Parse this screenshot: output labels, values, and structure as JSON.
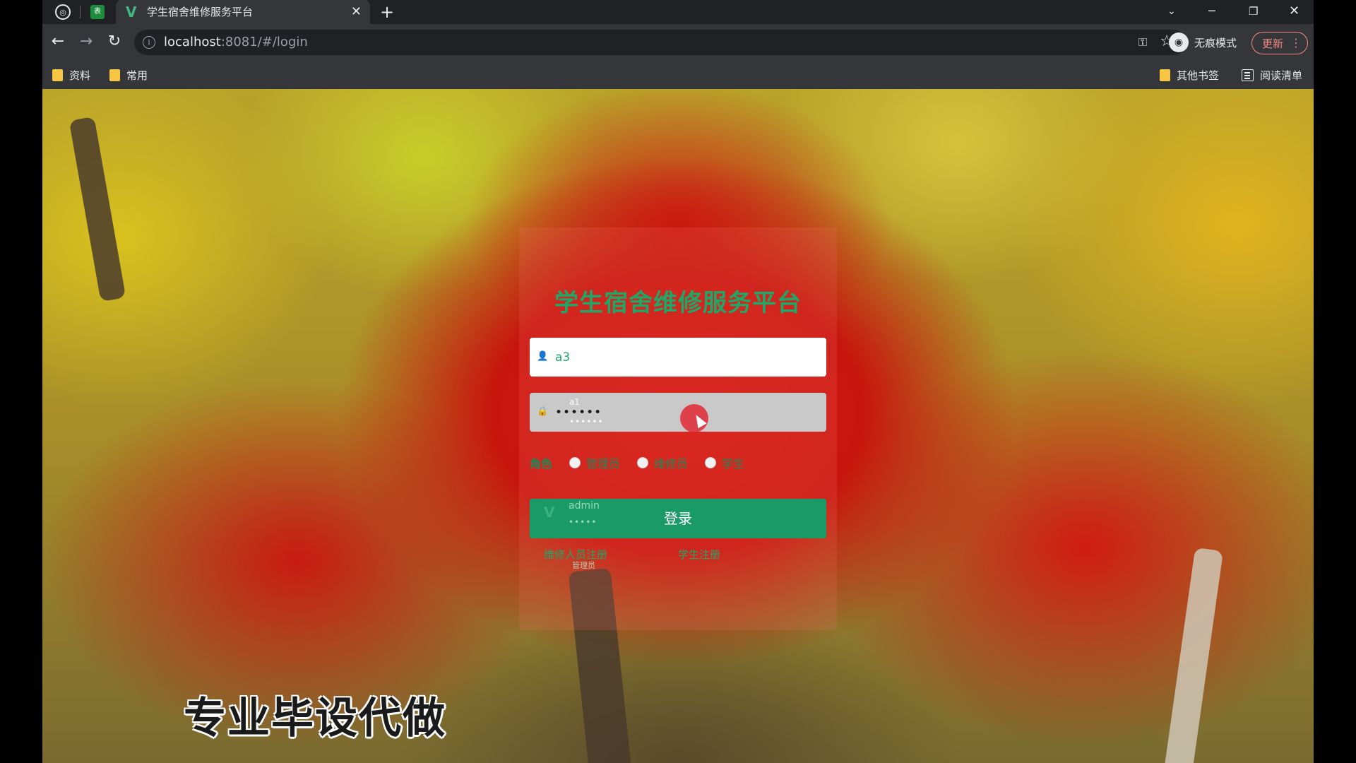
{
  "browser": {
    "tab": {
      "title": "学生宿舍维修服务平台",
      "favicon": "V",
      "app_icon": "表",
      "close": "✕",
      "new_tab": "+"
    },
    "window_controls": {
      "tablist": "⌄",
      "minimize": "─",
      "maximize": "❐",
      "close": "✕"
    },
    "address": {
      "host": "localhost",
      "rest": ":8081/#/login"
    },
    "incognito_label": "无痕模式",
    "update_label": "更新",
    "bookmarks": [
      {
        "label": "资料"
      },
      {
        "label": "常用"
      },
      {
        "label": "其他书签"
      },
      {
        "label": "阅读清单"
      }
    ]
  },
  "login": {
    "title": "学生宿舍维修服务平台",
    "username_value": "a3",
    "password_value": "••••••",
    "autofill_hint_user": "a1",
    "autofill_hint_dots": "••••••",
    "role_label": "角色",
    "roles": [
      {
        "label": "管理员"
      },
      {
        "label": "维修员"
      },
      {
        "label": "学生"
      }
    ],
    "login_button": "登录",
    "button_ghost_user": "admin",
    "button_ghost_dots": "•••••",
    "register_links": [
      {
        "label": "维修人员注册"
      },
      {
        "label": "学生注册"
      }
    ],
    "ghost_admin": "管理员"
  },
  "watermark": "专业毕设代做",
  "colors": {
    "accent": "#1ea868",
    "button": "#1a9a66",
    "cursor_highlight": "#e22836"
  }
}
